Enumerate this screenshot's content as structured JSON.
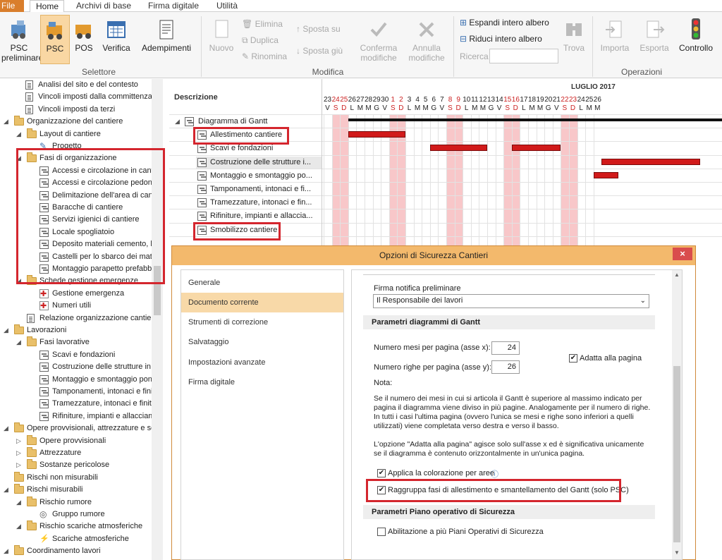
{
  "tabs": {
    "file": "File",
    "home": "Home",
    "archivi": "Archivi di base",
    "firma": "Firma digitale",
    "utilita": "Utilità"
  },
  "ribbon": {
    "psc_pre": "PSC preliminare",
    "psc": "PSC",
    "pos": "POS",
    "verifica": "Verifica",
    "adempimenti": "Adempimenti",
    "grp_selettore": "Selettore",
    "nuovo": "Nuovo",
    "elimina": "Elimina",
    "duplica": "Duplica",
    "rinomina": "Rinomina",
    "sposta_su": "Sposta su",
    "sposta_giu": "Sposta giù",
    "conferma": "Conferma modifiche",
    "annulla": "Annulla modifiche",
    "grp_modifica": "Modifica",
    "espandi": "Espandi intero albero",
    "riduci": "Riduci intero albero",
    "ricerca": "Ricerca",
    "trova": "Trova",
    "importa": "Importa",
    "esporta": "Esporta",
    "controllo": "Controllo",
    "grp_operazioni": "Operazioni"
  },
  "tree": [
    "Analisi del sito e del contesto",
    "Vincoli imposti dalla committenza",
    "Vincoli imposti da terzi",
    "Organizzazione del cantiere",
    "Layout di cantiere",
    "Progetto",
    "Fasi di organizzazione",
    "Accessi e circolazione in cantie",
    "Accessi e circolazione pedonale",
    "Delimitazione dell'area di cantie",
    "Baracche di cantiere",
    "Servizi igienici di cantiere",
    "Locale spogliatoio",
    "Deposito materiali cemento, la",
    "Castelli per lo sbarco dei mater",
    "Montaggio parapetto prefabbr",
    "Schede gestione emergenze",
    "Gestione emergenza",
    "Numeri utili",
    "Relazione organizzazione cantiere",
    "Lavorazioni",
    "Fasi lavorative",
    "Scavi e fondazioni",
    "Costruzione delle strutture in c",
    "Montaggio e smontaggio pont",
    "Tamponamenti, intonaci e finit",
    "Tramezzature, intonaci e finitu",
    "Rifiniture, impianti e allacciame",
    "Opere provvisionali, attrezzature e so",
    "Opere provvisionali",
    "Attrezzature",
    "Sostanze pericolose",
    "Rischi non misurabili",
    "Rischi misurabili",
    "Rischio rumore",
    "Gruppo rumore",
    "Rischio scariche atmosferiche",
    "Scariche atmosferiche",
    "Coordinamento lavori"
  ],
  "gantt": {
    "desc_header": "Descrizione",
    "month": "LUGLIO 2017",
    "root": "Diagramma di Gantt",
    "rows": [
      "Allestimento cantiere",
      "Scavi e fondazioni",
      "Costruzione delle strutture i...",
      "Montaggio e smontaggio po...",
      "Tamponamenti, intonaci e fi...",
      "Tramezzature, intonaci e fin...",
      "Rifiniture, impianti e allaccia...",
      "Smobilizzo cantiere"
    ],
    "days": [
      "23",
      "24",
      "25",
      "26",
      "27",
      "28",
      "29",
      "30",
      "1",
      "2",
      "3",
      "4",
      "5",
      "6",
      "7",
      "8",
      "9",
      "10",
      "11",
      "12",
      "13",
      "14",
      "15",
      "16",
      "17",
      "18",
      "19",
      "20",
      "21",
      "22",
      "23",
      "24",
      "25",
      "26"
    ],
    "wdays": [
      "V",
      "S",
      "D",
      "L",
      "M",
      "M",
      "G",
      "V",
      "S",
      "D",
      "L",
      "M",
      "M",
      "G",
      "V",
      "S",
      "D",
      "L",
      "M",
      "M",
      "G",
      "V",
      "S",
      "D",
      "L",
      "M",
      "M",
      "G",
      "V",
      "S",
      "D",
      "L",
      "M",
      "M"
    ],
    "weekend_idx": [
      1,
      2,
      8,
      9,
      15,
      16,
      22,
      23,
      29,
      30
    ]
  },
  "dialog": {
    "title": "Opzioni di Sicurezza Cantieri",
    "close": "×",
    "nav": [
      "Generale",
      "Documento corrente",
      "Strumenti di correzione",
      "Salvataggio",
      "Impostazioni avanzate",
      "Firma digitale"
    ],
    "firma_label": "Firma notifica preliminare",
    "firma_value": "Il Responsabile dei lavori",
    "sec_gantt": "Parametri diagrammi di Gantt",
    "mesi_label": "Numero mesi per pagina (asse x):",
    "mesi_value": "24",
    "righe_label": "Numero righe per pagina (asse y):",
    "righe_value": "26",
    "adatta": "Adatta alla pagina",
    "nota": "Nota:",
    "nota1": "Se il numero dei mesi in cui si articola il Gantt è superiore al massimo indicato per pagina il diagramma viene diviso in più pagine. Analogamente per il numero di righe.  In tutti i casi l'ultima pagina (ovvero l'unica se mesi e righe sono inferiori a quelli utilizzati) viene completata verso destra e verso il basso.",
    "nota2": "L'opzione \"Adatta alla pagina\" agisce solo sull'asse x ed è significativa unicamente se il diagramma è contenuto orizzontalmente in un'unica pagina.",
    "applica": "Applica la colorazione per aree",
    "raggruppa": "Raggruppa fasi di allestimento e smantellamento del Gantt (solo PSC)",
    "sec_pos": "Parametri Piano operativo di Sicurezza",
    "abilita": "Abilitazione a più Piani Operativi di Sicurezza",
    "check": "✔"
  }
}
